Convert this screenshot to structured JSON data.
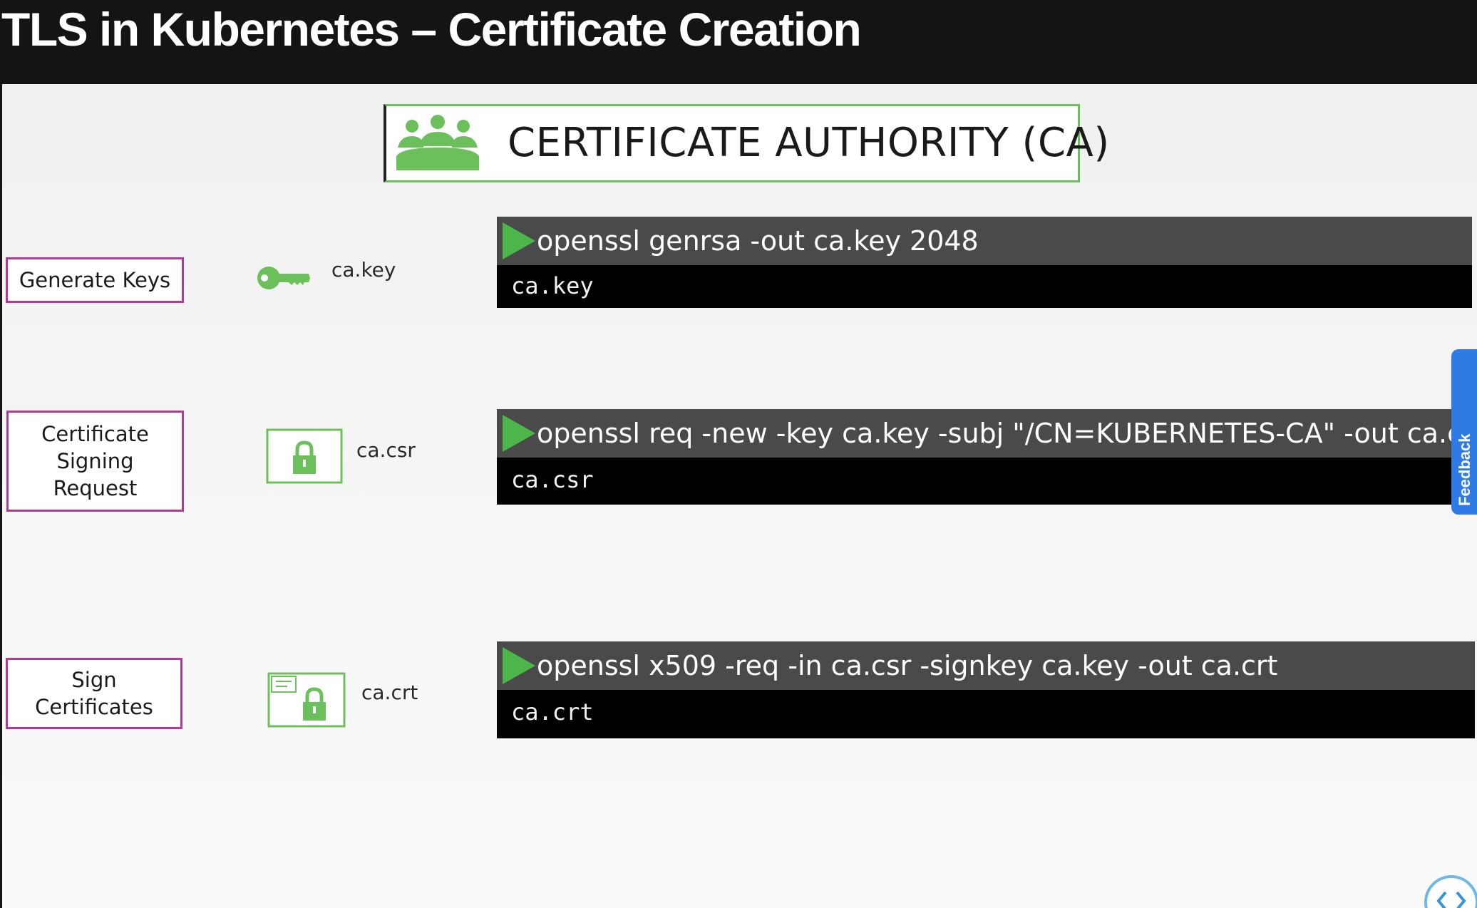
{
  "header": {
    "title": "TLS in Kubernetes – Certificate Creation"
  },
  "ca": {
    "title": "CERTIFICATE AUTHORITY (CA)",
    "icon": "group-icon"
  },
  "steps": [
    {
      "label": "Generate Keys",
      "file_icon": "key-icon",
      "file_name": "ca.key",
      "command": "openssl genrsa -out ca.key 2048",
      "output": "ca.key"
    },
    {
      "label": "Certificate\nSigning\nRequest",
      "file_icon": "lock-icon",
      "file_name": "ca.csr",
      "command": "openssl req -new -key ca.key -subj  \"/CN=KUBERNETES-CA\" -out ca.csr",
      "output": "ca.csr"
    },
    {
      "label": "Sign\nCertificates",
      "file_icon": "certificate-lock-icon",
      "file_name": "ca.crt",
      "command": "openssl x509 -req -in ca.csr -signkey ca.key -out ca.crt",
      "output": "ca.crt"
    }
  ],
  "feedback": {
    "label": "Feedback"
  },
  "colors": {
    "accent_green": "#6cc05c",
    "label_border": "#b03a94",
    "terminal_bar": "#4a4a4a",
    "feedback_blue": "#2f7be6"
  }
}
